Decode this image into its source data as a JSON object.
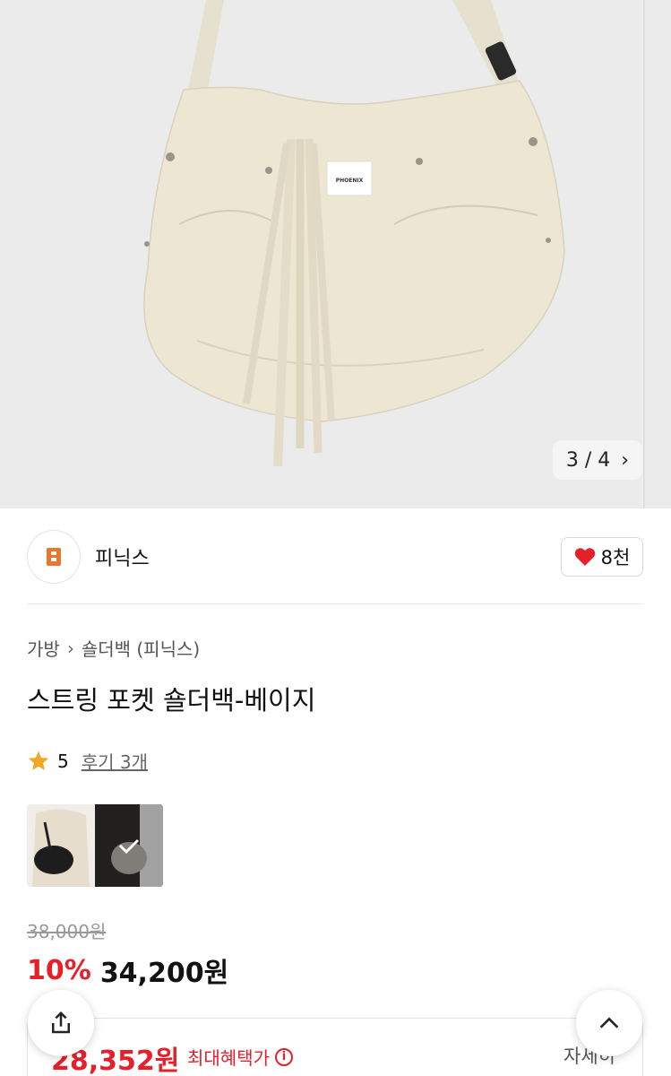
{
  "gallery": {
    "current": 3,
    "total": 4,
    "counter_text": "3 / 4",
    "next_icon": "chevron-right-icon",
    "logo_text": "PHOENIX"
  },
  "brand": {
    "name": "피닉스",
    "logo_icon": "brand-logo-icon",
    "likes": "8천",
    "like_icon": "heart-icon"
  },
  "breadcrumb": {
    "category": "가방",
    "subcategory": "숄더백 (피닉스)"
  },
  "product": {
    "title": "스트링 포켓 숄더백-베이지"
  },
  "rating": {
    "score": "5",
    "reviews": "후기 3개"
  },
  "price": {
    "original": "38,000원",
    "discount": "10%",
    "sale": "34,200원"
  },
  "benefit": {
    "price": "28,352원",
    "label": "최대혜택가",
    "detail": "자세히"
  },
  "colors": {
    "accent": "#e5202a",
    "brand_orange": "#e8772e",
    "star": "#f5a623"
  }
}
